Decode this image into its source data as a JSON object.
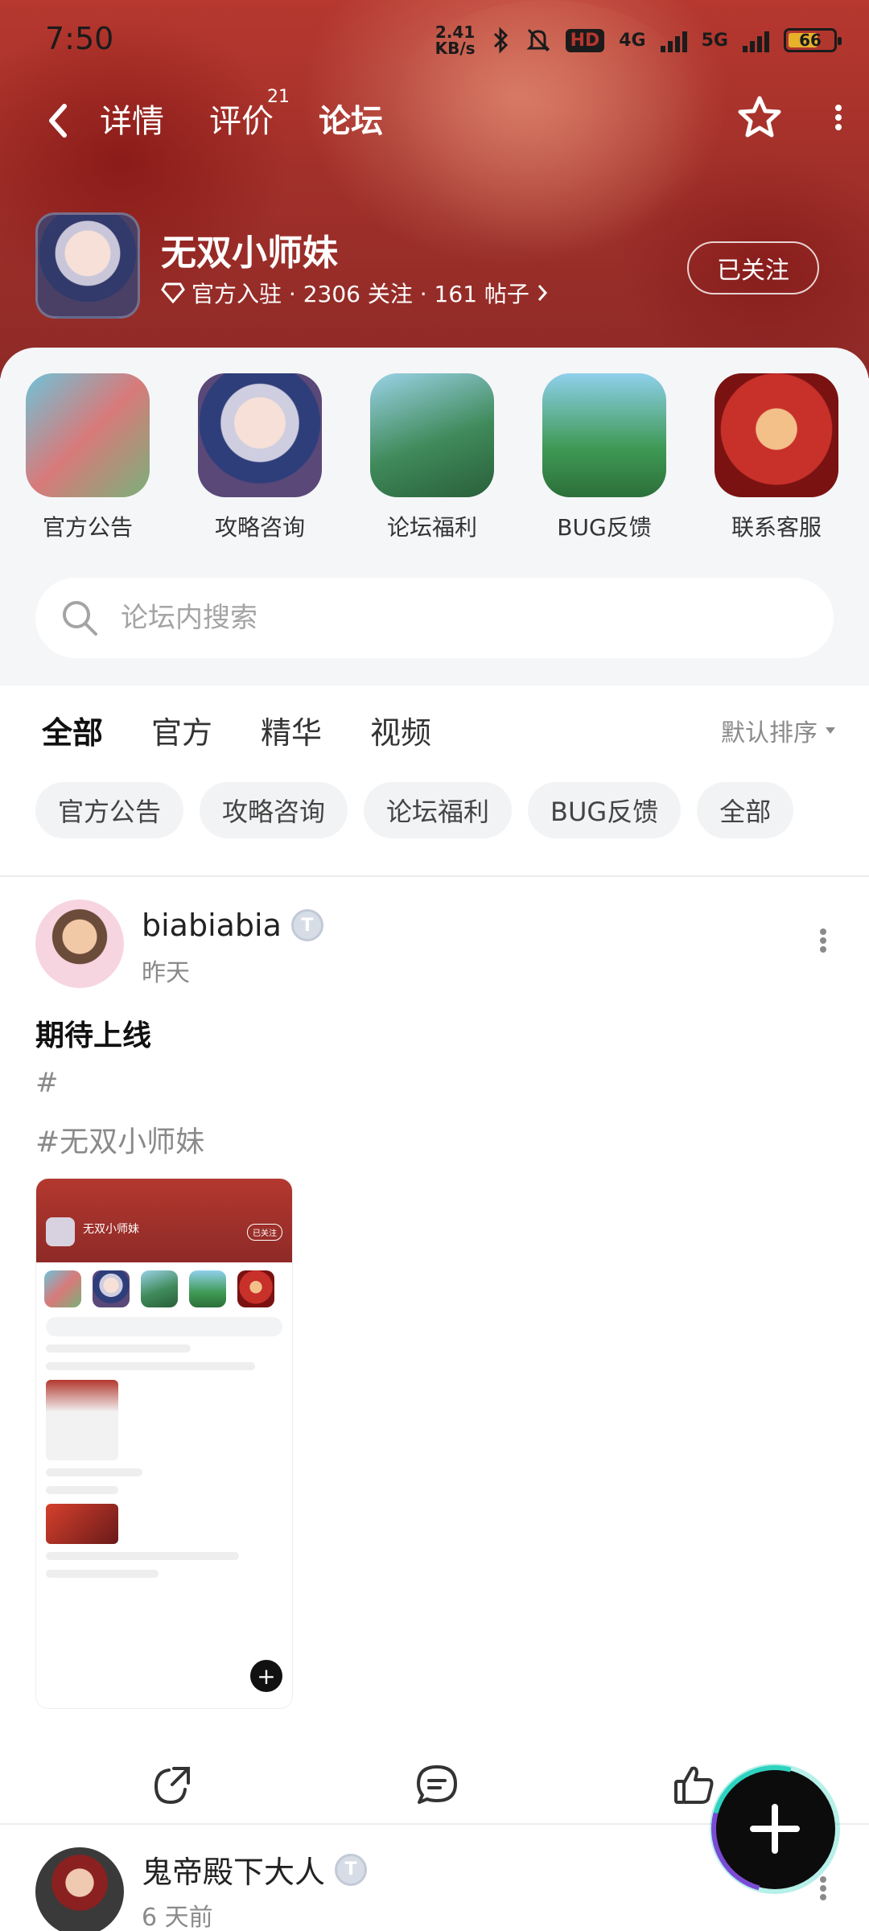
{
  "status_bar": {
    "time": "7:50",
    "speed_value": "2.41",
    "speed_unit": "KB/s",
    "hd_label": "HD",
    "net1": "4G",
    "net2": "5G",
    "battery": "66"
  },
  "nav": {
    "tabs": [
      {
        "label": "详情"
      },
      {
        "label": "评价",
        "badge": "21"
      },
      {
        "label": "论坛"
      }
    ]
  },
  "game": {
    "title": "无双小师妹",
    "meta": "官方入驻 · 2306 关注 · 161 帖子",
    "follow_label": "已关注"
  },
  "categories": [
    {
      "label": "官方公告"
    },
    {
      "label": "攻略咨询"
    },
    {
      "label": "论坛福利"
    },
    {
      "label": "BUG反馈"
    },
    {
      "label": "联系客服"
    }
  ],
  "search": {
    "placeholder": "论坛内搜索"
  },
  "filter_tabs": [
    {
      "label": "全部"
    },
    {
      "label": "官方"
    },
    {
      "label": "精华"
    },
    {
      "label": "视频"
    }
  ],
  "sort_label": "默认排序",
  "chips": [
    {
      "label": "官方公告"
    },
    {
      "label": "攻略咨询"
    },
    {
      "label": "论坛福利"
    },
    {
      "label": "BUG反馈"
    },
    {
      "label": "全部"
    }
  ],
  "posts": [
    {
      "user": "biabiabia",
      "time": "昨天",
      "title": "期待上线",
      "tag1": "#",
      "tag2": "#无双小师妹",
      "screenshot_title": "无双小师妹",
      "screenshot_follow": "已关注"
    },
    {
      "user": "鬼帝殿下大人",
      "time": "6 天前"
    }
  ],
  "level_badge": "T"
}
